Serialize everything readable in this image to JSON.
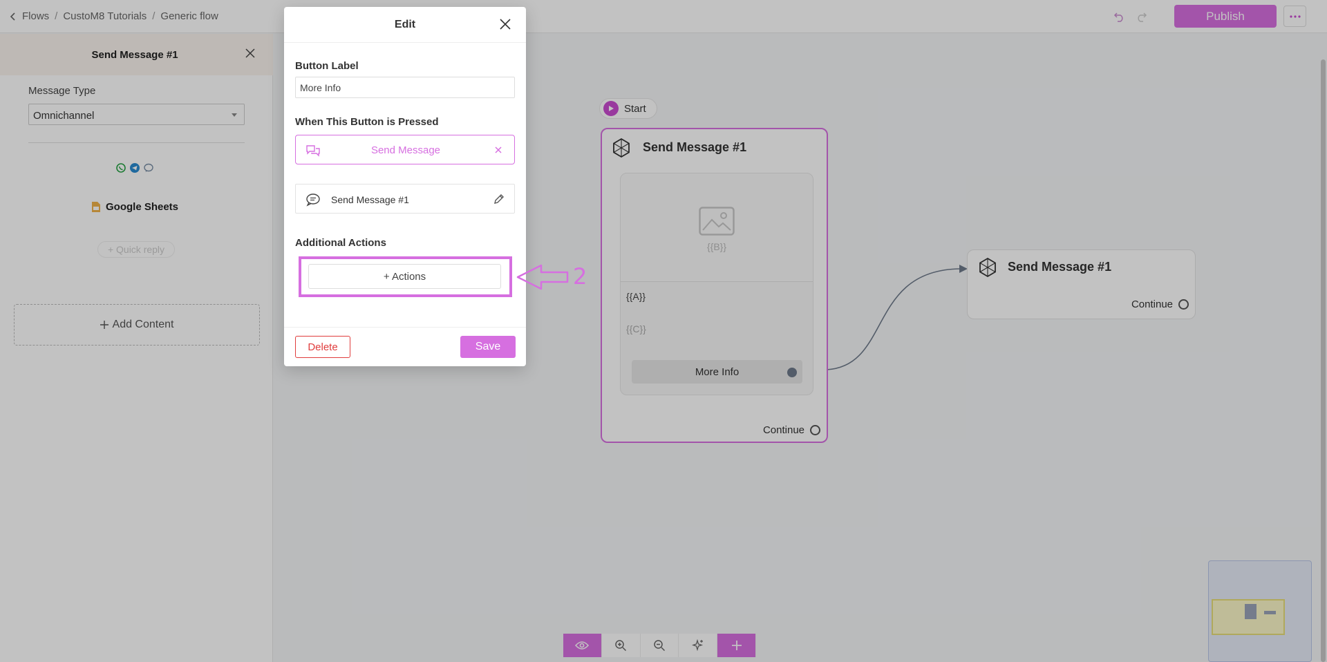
{
  "breadcrumb": {
    "items": [
      "Flows",
      "CustoM8 Tutorials",
      "Generic flow"
    ]
  },
  "header": {
    "publish_label": "Publish"
  },
  "left_panel": {
    "title": "Send Message #1",
    "message_type_label": "Message Type",
    "message_type_value": "Omnichannel",
    "channel_icons": [
      "whatsapp-icon",
      "telegram-icon",
      "messenger-icon"
    ],
    "integration_label": "Google Sheets",
    "quick_reply_label": "+ Quick reply",
    "add_content_label": "Add Content"
  },
  "canvas": {
    "start_label": "Start",
    "node_main": {
      "title": "Send Message #1",
      "media_var": "{{B}}",
      "text_var_a": "{{A}}",
      "text_var_c": "{{C}}",
      "button_label": "More Info",
      "continue_label": "Continue"
    },
    "node_target": {
      "title": "Send Message #1",
      "continue_label": "Continue"
    }
  },
  "modal": {
    "title": "Edit",
    "button_label_heading": "Button Label",
    "button_label_value": "More Info",
    "pressed_heading": "When This Button is Pressed",
    "pressed_action": "Send Message",
    "target_message": "Send Message #1",
    "additional_heading": "Additional Actions",
    "actions_button": "+ Actions",
    "delete_label": "Delete",
    "save_label": "Save"
  },
  "annotation": {
    "step_number": "2"
  },
  "colors": {
    "accent": "#d66fe0",
    "danger": "#e03c3c",
    "port": "#6e7a8a"
  }
}
